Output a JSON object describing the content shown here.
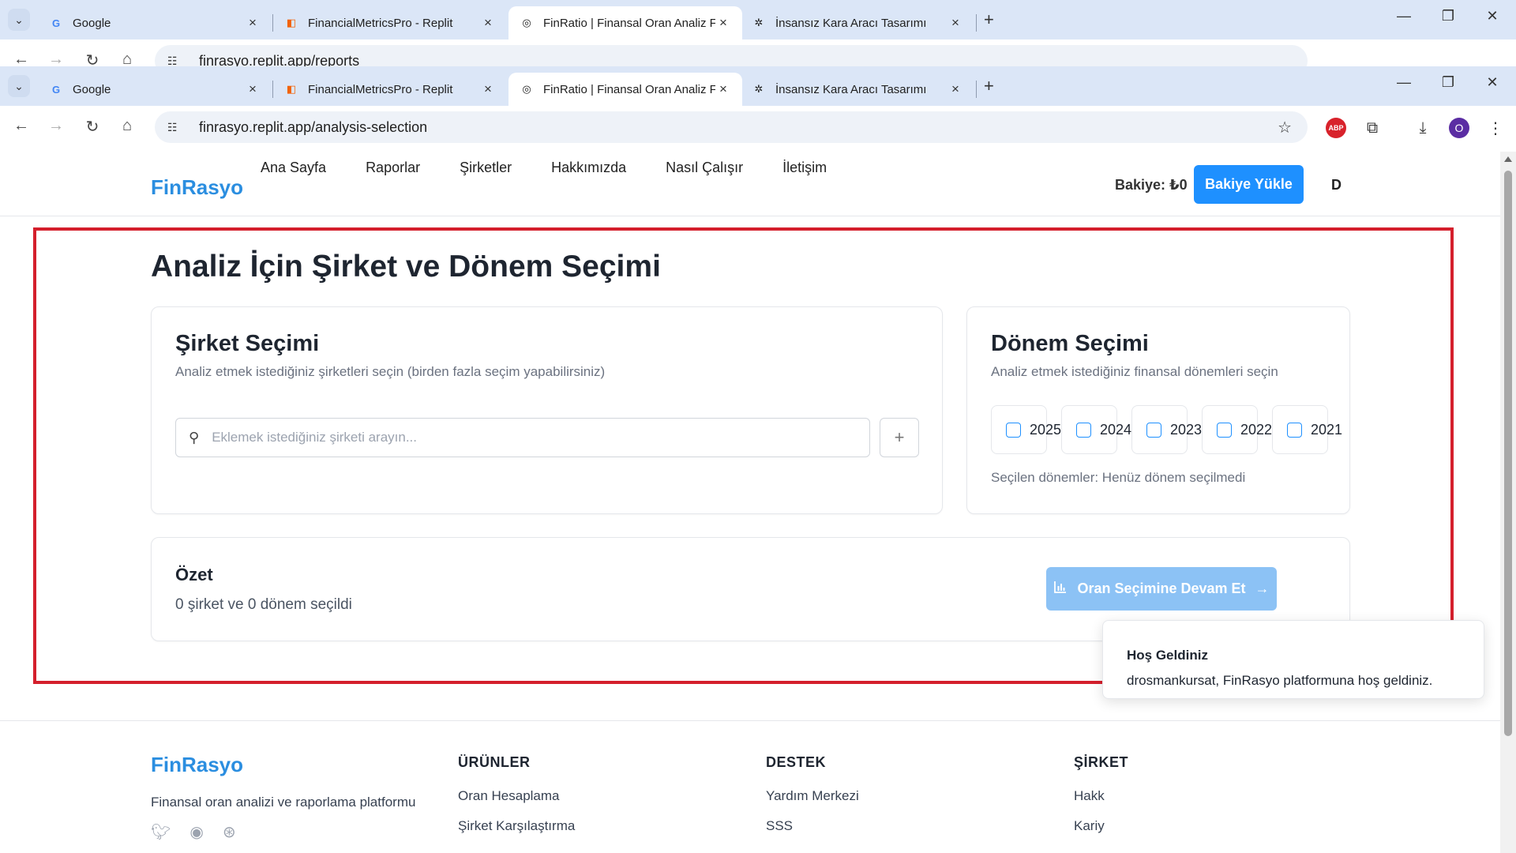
{
  "browser_back": {
    "tabs": [
      {
        "title": "Google",
        "favicon": "google-icon"
      },
      {
        "title": "FinancialMetricsPro - Replit",
        "favicon": "replit-icon"
      },
      {
        "title": "FinRatio | Finansal Oran Analiz F",
        "favicon": "globe-icon"
      },
      {
        "title": "İnsansız Kara Aracı Tasarımı",
        "favicon": "openai-icon"
      }
    ],
    "url": "finrasyo.replit.app/reports"
  },
  "browser": {
    "tabs": [
      {
        "title": "Google",
        "favicon": "google-icon"
      },
      {
        "title": "FinancialMetricsPro - Replit",
        "favicon": "replit-icon"
      },
      {
        "title": "FinRatio | Finansal Oran Analiz F",
        "favicon": "globe-icon"
      },
      {
        "title": "İnsansız Kara Aracı Tasarımı",
        "favicon": "openai-icon"
      }
    ],
    "url": "finrasyo.replit.app/analysis-selection",
    "profile_initial": "O",
    "abp_label": "ABP"
  },
  "header": {
    "logo": "FinRasyo",
    "nav": [
      "Ana Sayfa",
      "Raporlar",
      "Şirketler",
      "Hakkımızda",
      "Nasıl Çalışır",
      "İletişim"
    ],
    "balance": "Bakiye: ₺0",
    "topup_button": "Bakiye Yükle",
    "user_initial": "D"
  },
  "main": {
    "title": "Analiz İçin Şirket ve Dönem Seçimi",
    "company_card": {
      "title": "Şirket Seçimi",
      "description": "Analiz etmek istediğiniz şirketleri seçin (birden fazla seçim yapabilirsiniz)",
      "search_placeholder": "Eklemek istediğiniz şirketi arayın...",
      "add_icon": "+"
    },
    "period_card": {
      "title": "Dönem Seçimi",
      "description": "Analiz etmek istediğiniz finansal dönemleri seçin",
      "years": [
        "2025",
        "2024",
        "2023",
        "2022",
        "2021"
      ],
      "selected_text": "Seçilen dönemler: Henüz dönem seçilmedi"
    },
    "summary": {
      "title": "Özet",
      "text": "0 şirket ve 0 dönem seçildi",
      "continue_button": "Oran Seçimine Devam Et"
    }
  },
  "footer": {
    "logo": "FinRasyo",
    "tagline": "Finansal oran analizi ve raporlama platformu",
    "columns": [
      {
        "title": "ÜRÜNLER",
        "links": [
          "Oran Hesaplama",
          "Şirket Karşılaştırma"
        ]
      },
      {
        "title": "DESTEK",
        "links": [
          "Yardım Merkezi",
          "SSS"
        ]
      },
      {
        "title": "ŞİRKET",
        "links": [
          "Hakk",
          "Kariy"
        ]
      }
    ]
  },
  "toast": {
    "title": "Hoş Geldiniz",
    "body": "drosmankursat, FinRasyo platformuna hoş geldiniz."
  },
  "colors": {
    "accent": "#1e90ff",
    "logo": "#2b8ee0",
    "highlight": "#d41f2c",
    "disabled_button": "#8cc2f5"
  }
}
